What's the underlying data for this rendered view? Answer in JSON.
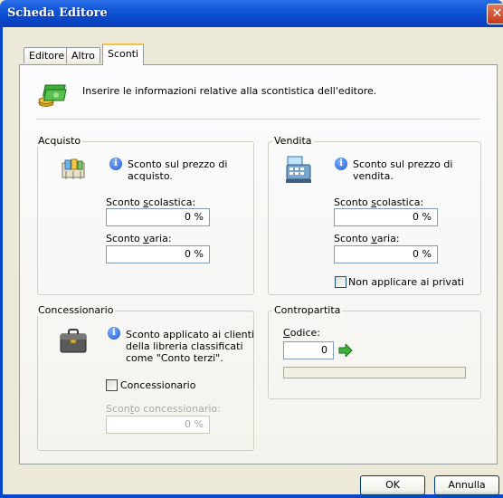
{
  "window": {
    "title": "Scheda Editore",
    "close_glyph": "✕"
  },
  "tabs": [
    {
      "label": "Editore"
    },
    {
      "label": "Altro"
    },
    {
      "label": "Sconti",
      "active": true
    }
  ],
  "intro": {
    "text": "Inserire le informazioni relative alla scontistica dell'editore.",
    "icon": "coins-money-icon"
  },
  "acquisto": {
    "title": "Acquisto",
    "info": [
      "Sconto sul prezzo di",
      "acquisto."
    ],
    "scolastica_label_pre": "Sconto ",
    "scolastica_label_acc": "s",
    "scolastica_label_post": "colastica:",
    "scolastica_value": "0 %",
    "varia_label_pre": "Sconto ",
    "varia_label_acc": "v",
    "varia_label_post": "aria:",
    "varia_value": "0 %"
  },
  "vendita": {
    "title": "Vendita",
    "info": [
      "Sconto sul prezzo di",
      "vendita."
    ],
    "scolastica_label_pre": "Sconto ",
    "scolastica_label_acc": "s",
    "scolastica_label_post": "colastica:",
    "scolastica_value": "0 %",
    "varia_label_pre": "Sconto ",
    "varia_label_acc": "v",
    "varia_label_post": "aria:",
    "varia_value": "0 %",
    "checkbox_label": "Non applicare ai privati",
    "checkbox_checked": false
  },
  "concessionario": {
    "title": "Concessionario",
    "info": [
      "Sconto applicato ai clienti",
      "della libreria classificati",
      "come \"Conto terzi\"."
    ],
    "checkbox_label": "Concessionario",
    "checkbox_checked": false,
    "sconto_label_pre": "Scon",
    "sconto_label_acc": "t",
    "sconto_label_post": "o concessionario:",
    "sconto_value": "0 %"
  },
  "contropartita": {
    "title": "Contropartita",
    "codice_label_acc": "C",
    "codice_label_post": "odice:",
    "codice_value": "0",
    "arrow_icon": "green-arrow-icon"
  },
  "buttons": {
    "ok": "OK",
    "cancel": "Annulla"
  }
}
